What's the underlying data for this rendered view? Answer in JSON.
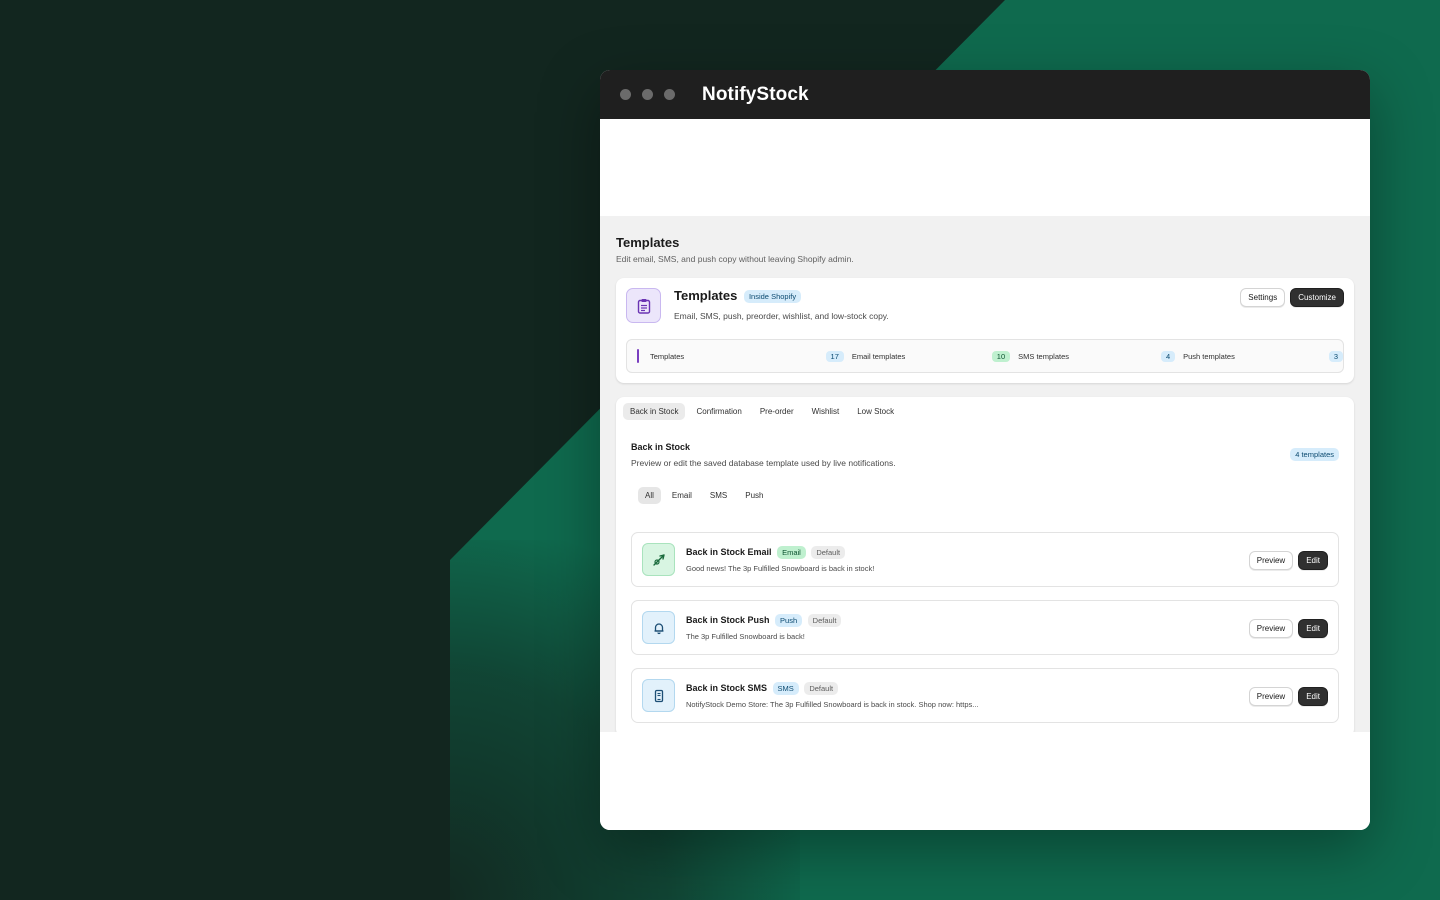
{
  "app": {
    "title": "NotifyStock"
  },
  "page": {
    "title": "Templates",
    "subtitle": "Edit email, SMS, and push copy without leaving Shopify admin."
  },
  "header_card": {
    "title": "Templates",
    "badge": "Inside Shopify",
    "description": "Email, SMS, push, preorder, wishlist, and low-stock copy.",
    "settings_label": "Settings",
    "customize_label": "Customize",
    "stats": [
      {
        "label": "Templates",
        "count": "17"
      },
      {
        "label": "Email templates",
        "count": "10"
      },
      {
        "label": "SMS templates",
        "count": "4"
      },
      {
        "label": "Push templates",
        "count": "3"
      }
    ]
  },
  "tabs": [
    "Back in Stock",
    "Confirmation",
    "Pre-order",
    "Wishlist",
    "Low Stock"
  ],
  "active_tab": "Back in Stock",
  "section": {
    "title": "Back in Stock",
    "subtitle": "Preview or edit the saved database template used by live notifications.",
    "badge": "4 templates"
  },
  "filters": [
    "All",
    "Email",
    "SMS",
    "Push"
  ],
  "active_filter": "All",
  "templates": [
    {
      "title": "Back in Stock Email",
      "type": "Email",
      "status": "Default",
      "desc": "Good news! The 3p Fulfilled Snowboard is back in stock!",
      "icon": "send-icon"
    },
    {
      "title": "Back in Stock Push",
      "type": "Push",
      "status": "Default",
      "desc": "The 3p Fulfilled Snowboard is back!",
      "icon": "bell-icon"
    },
    {
      "title": "Back in Stock SMS",
      "type": "SMS",
      "status": "Default",
      "desc": "NotifyStock Demo Store: The 3p Fulfilled Snowboard is back in stock. Shop now: https...",
      "icon": "phone-icon"
    }
  ],
  "row_actions": {
    "preview": "Preview",
    "edit": "Edit"
  },
  "colors": {
    "accent": "#7a3fc0",
    "background_dark": "#12261f",
    "background_green": "#0f6a4e",
    "titlebar": "#1f1f1f",
    "primary_button": "#303030"
  }
}
